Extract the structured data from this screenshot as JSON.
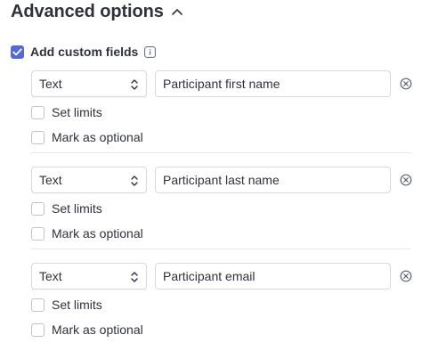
{
  "section": {
    "title": "Advanced options",
    "expanded": true
  },
  "custom_fields_toggle": {
    "label": "Add custom fields",
    "checked": true
  },
  "fields": [
    {
      "type": "Text",
      "name": "Participant first name",
      "limits_label": "Set limits",
      "optional_label": "Mark as optional"
    },
    {
      "type": "Text",
      "name": "Participant last name",
      "limits_label": "Set limits",
      "optional_label": "Mark as optional"
    },
    {
      "type": "Text",
      "name": "Participant email",
      "limits_label": "Set limits",
      "optional_label": "Mark as optional"
    }
  ],
  "colors": {
    "accent": "#5469d4",
    "text": "#30313d",
    "border": "#d7dae0",
    "divider": "#e6e8ec"
  }
}
